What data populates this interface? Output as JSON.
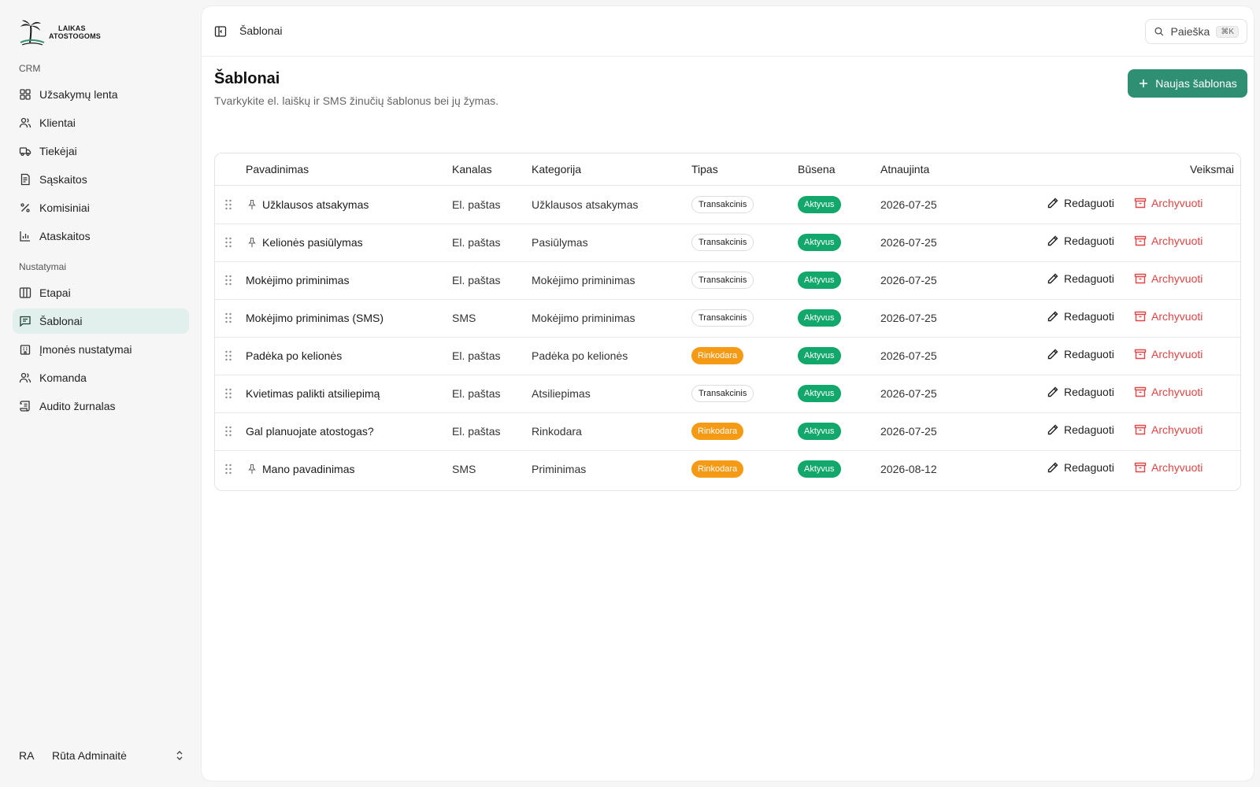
{
  "brand": {
    "line1": "LAIKAS",
    "line2": "ATOSTOGOMS"
  },
  "sidebar": {
    "groups": [
      {
        "label": "CRM"
      },
      {
        "label": "Nustatymai"
      }
    ],
    "items": [
      {
        "label": "Užsakymų lenta",
        "icon": "grid-icon"
      },
      {
        "label": "Klientai",
        "icon": "users-icon"
      },
      {
        "label": "Tiekėjai",
        "icon": "truck-icon"
      },
      {
        "label": "Sąskaitos",
        "icon": "receipt-icon"
      },
      {
        "label": "Komisiniai",
        "icon": "percent-icon"
      },
      {
        "label": "Ataskaitos",
        "icon": "bar-chart-icon"
      },
      {
        "label": "Etapai",
        "icon": "columns-icon"
      },
      {
        "label": "Šablonai",
        "icon": "message-square-icon",
        "active": true
      },
      {
        "label": "Įmonės nustatymai",
        "icon": "building-icon"
      },
      {
        "label": "Komanda",
        "icon": "users-icon"
      },
      {
        "label": "Audito žurnalas",
        "icon": "scroll-icon"
      }
    ],
    "user": {
      "initials": "RA",
      "name": "Rūta Adminaitė"
    }
  },
  "topbar": {
    "breadcrumb": "Šablonai",
    "search": {
      "label": "Paieška",
      "shortcut": "⌘K"
    }
  },
  "page": {
    "title": "Šablonai",
    "subtitle": "Tvarkykite el. laiškų ir SMS žinučių šablonus bei jų žymas.",
    "new_button": "Naujas šablonas"
  },
  "table": {
    "headers": {
      "name": "Pavadinimas",
      "channel": "Kanalas",
      "category": "Kategorija",
      "type": "Tipas",
      "status": "Būsena",
      "updated": "Atnaujinta",
      "actions": "Veiksmai"
    },
    "edit_label": "Redaguoti",
    "archive_label": "Archyvuoti",
    "rows": [
      {
        "pinned": true,
        "name": "Užklausos atsakymas",
        "channel": "El. paštas",
        "category": "Užklausos atsakymas",
        "type": "Transakcinis",
        "type_kind": "trans",
        "status": "Aktyvus",
        "updated": "2026-07-25"
      },
      {
        "pinned": true,
        "name": "Kelionės pasiūlymas",
        "channel": "El. paštas",
        "category": "Pasiūlymas",
        "type": "Transakcinis",
        "type_kind": "trans",
        "status": "Aktyvus",
        "updated": "2026-07-25"
      },
      {
        "pinned": false,
        "name": "Mokėjimo priminimas",
        "channel": "El. paštas",
        "category": "Mokėjimo priminimas",
        "type": "Transakcinis",
        "type_kind": "trans",
        "status": "Aktyvus",
        "updated": "2026-07-25"
      },
      {
        "pinned": false,
        "name": "Mokėjimo priminimas (SMS)",
        "channel": "SMS",
        "category": "Mokėjimo priminimas",
        "type": "Transakcinis",
        "type_kind": "trans",
        "status": "Aktyvus",
        "updated": "2026-07-25"
      },
      {
        "pinned": false,
        "name": "Padėka po kelionės",
        "channel": "El. paštas",
        "category": "Padėka po kelionės",
        "type": "Rinkodara",
        "type_kind": "marketing",
        "status": "Aktyvus",
        "updated": "2026-07-25"
      },
      {
        "pinned": false,
        "name": "Kvietimas palikti atsiliepimą",
        "channel": "El. paštas",
        "category": "Atsiliepimas",
        "type": "Transakcinis",
        "type_kind": "trans",
        "status": "Aktyvus",
        "updated": "2026-07-25"
      },
      {
        "pinned": false,
        "name": "Gal planuojate atostogas?",
        "channel": "El. paštas",
        "category": "Rinkodara",
        "type": "Rinkodara",
        "type_kind": "marketing",
        "status": "Aktyvus",
        "updated": "2026-07-25"
      },
      {
        "pinned": true,
        "name": "Mano pavadinimas",
        "channel": "SMS",
        "category": "Priminimas",
        "type": "Rinkodara",
        "type_kind": "marketing",
        "status": "Aktyvus",
        "updated": "2026-08-12"
      }
    ]
  },
  "colors": {
    "accent": "#2f8f72",
    "active_nav_bg": "#e1f0ec",
    "status_active": "#13a86b",
    "marketing_badge": "#f59a14",
    "archive": "#e04444"
  }
}
